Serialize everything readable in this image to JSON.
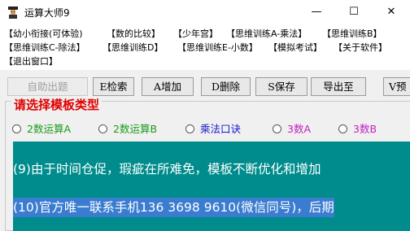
{
  "window": {
    "title": "运算大师9",
    "minimize": "—",
    "maximize": "☐",
    "close": "✕"
  },
  "menu": [
    "【幼小衔接(可体验)",
    "【数的比较】",
    "【少年宫】",
    "【思维训练A-乘法】",
    "【思维训练B】",
    "【思维训练C-除法】",
    "【思维训练D】",
    "【思维训练E-小数】",
    "【模拟考试】",
    "【关于软件】",
    "【退出窗口】"
  ],
  "toolbar": {
    "auto": "自助出题",
    "search": "E检索",
    "add": "A增加",
    "delete": "D删除",
    "save": "S保存",
    "export": "导出至",
    "preview": "V预"
  },
  "section_title": "请选择模板类型",
  "template_types": [
    {
      "label": "2数运算A",
      "color": "#1a9a1a"
    },
    {
      "label": "2数运算B",
      "color": "#1a9a1a"
    },
    {
      "label": "乘法口诀",
      "color": "#1a1acc"
    },
    {
      "label": "3数A",
      "color": "#c020c0"
    },
    {
      "label": "3数B",
      "color": "#c020c0"
    }
  ],
  "content": {
    "line1": "(9)由于时间仓促，瑕疵在所难免，模板不断优化和增加",
    "line2": "(10)官方唯一联系手机136 3698 9610(微信同号)，后期"
  }
}
